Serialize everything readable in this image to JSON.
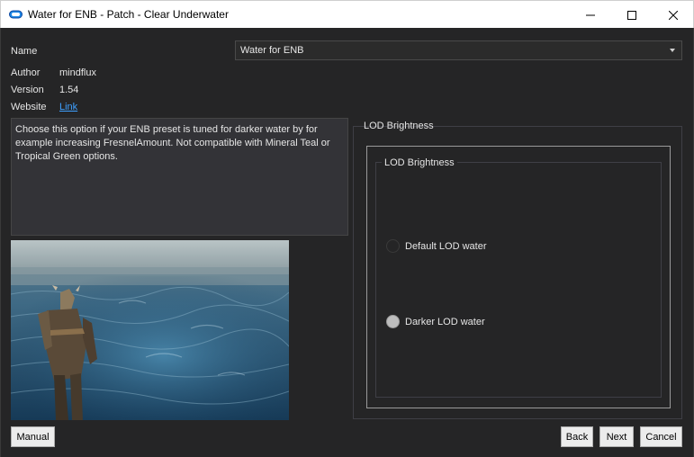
{
  "window": {
    "title": "Water for ENB - Patch - Clear Underwater",
    "controls": {
      "minimize": "—",
      "maximize": "☐",
      "close": "✕"
    },
    "icon": "cloud-icon"
  },
  "info": {
    "name_label": "Name",
    "name_value": "Water for ENB",
    "author_label": "Author",
    "author_value": "mindflux",
    "version_label": "Version",
    "version_value": "1.54",
    "website_label": "Website",
    "website_value": "Link"
  },
  "description": "Choose this option if your ENB preset is tuned for darker water by for example increasing FresnelAmount. Not compatible with Mineral Teal or Tropical Green options.",
  "options": {
    "group_title": "LOD Brightness",
    "inner_group_title": "LOD Brightness",
    "items": [
      {
        "label": "Default LOD water",
        "checked": false
      },
      {
        "label": "Darker LOD water",
        "checked": true
      }
    ]
  },
  "buttons": {
    "manual": "Manual",
    "back": "Back",
    "next": "Next",
    "cancel": "Cancel"
  },
  "colors": {
    "background": "#252526",
    "link": "#3ea0ff",
    "accent_icon": "#1e88e5"
  }
}
